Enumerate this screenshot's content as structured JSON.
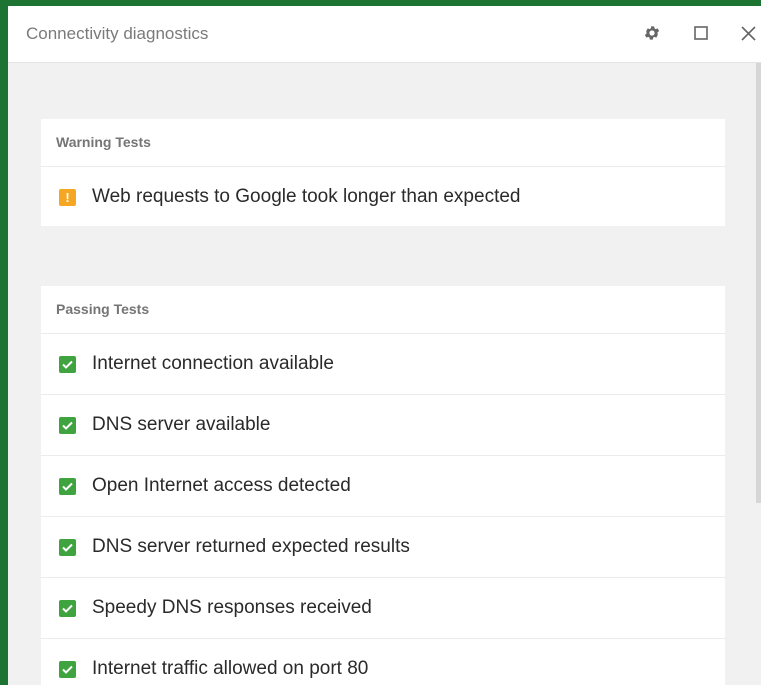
{
  "window": {
    "title": "Connectivity diagnostics"
  },
  "titlebar": {
    "settings_icon": "gear-icon",
    "maximize_icon": "square-icon",
    "close_icon": "close-icon"
  },
  "warning_section": {
    "header": "Warning Tests",
    "icon": "warning-icon",
    "color": "#f5a623",
    "items": [
      {
        "text": "Web requests to Google took longer than expected"
      }
    ]
  },
  "passing_section": {
    "header": "Passing Tests",
    "icon": "checkmark-icon",
    "color": "#3fa33f",
    "items": [
      {
        "text": "Internet connection available"
      },
      {
        "text": "DNS server available"
      },
      {
        "text": "Open Internet access detected"
      },
      {
        "text": "DNS server returned expected results"
      },
      {
        "text": "Speedy DNS responses received"
      },
      {
        "text": "Internet traffic allowed on port 80"
      }
    ]
  }
}
